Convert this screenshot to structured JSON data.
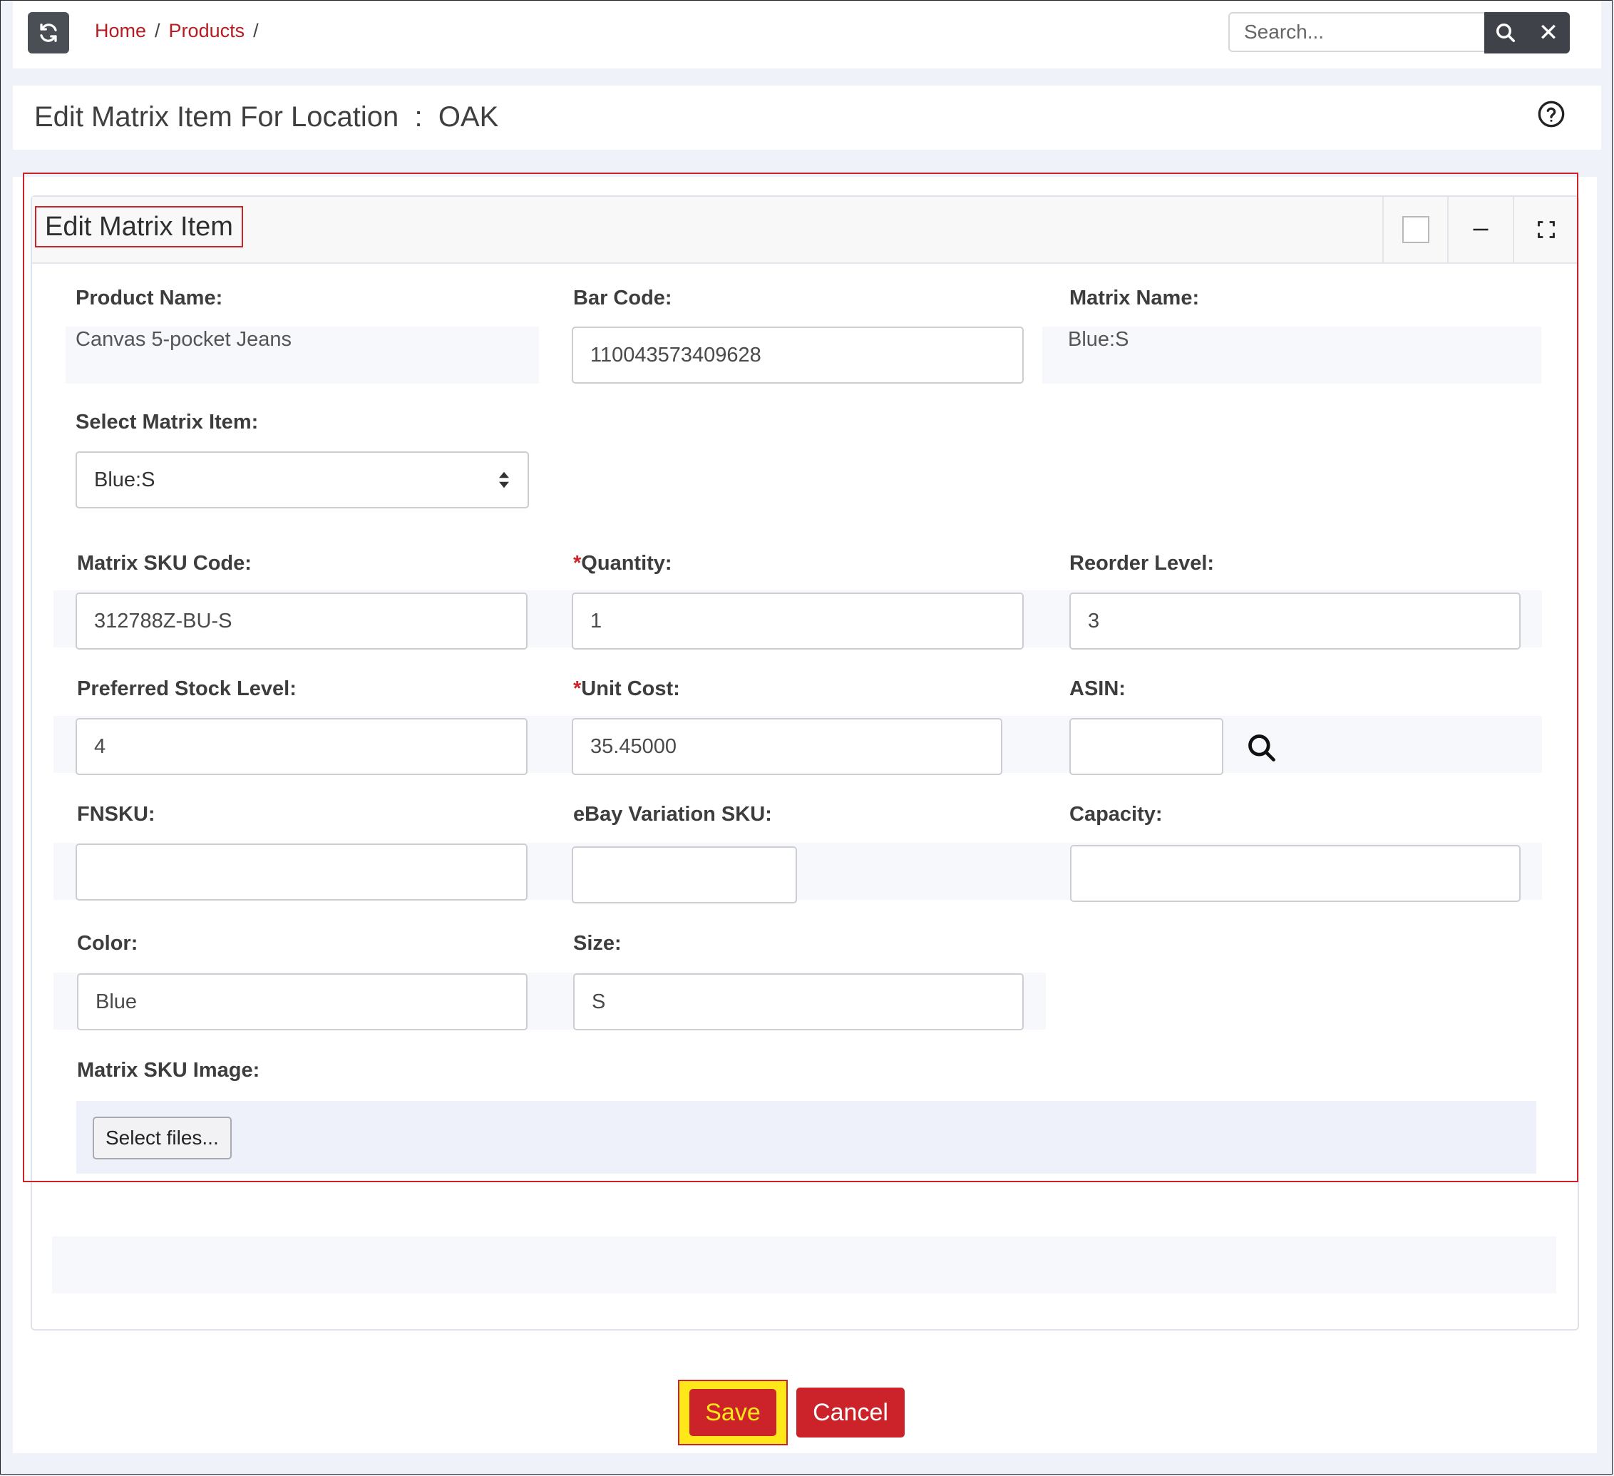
{
  "breadcrumb": {
    "home": "Home",
    "products": "Products",
    "sep": "/"
  },
  "search": {
    "placeholder": "Search...",
    "clear_glyph": "✕"
  },
  "page": {
    "title": "Edit Matrix Item For Location  :  OAK"
  },
  "box": {
    "title": "Edit Matrix Item"
  },
  "form": {
    "product_name_label": "Product Name:",
    "product_name": "Canvas 5-pocket Jeans",
    "bar_code_label": "Bar Code:",
    "bar_code": "110043573409628",
    "matrix_name_label": "Matrix Name:",
    "matrix_name": "Blue:S",
    "select_matrix_label": "Select Matrix Item:",
    "select_matrix_value": "Blue:S",
    "matrix_sku_label": "Matrix SKU Code:",
    "matrix_sku": "312788Z-BU-S",
    "required_mark": "*",
    "quantity_label": "Quantity:",
    "quantity": "1",
    "reorder_label": "Reorder Level:",
    "reorder": "3",
    "preferred_label": "Preferred Stock Level:",
    "preferred": "4",
    "unit_cost_label": "Unit Cost:",
    "unit_cost": "35.45000",
    "asin_label": "ASIN:",
    "asin": "",
    "fnsku_label": "FNSKU:",
    "fnsku": "",
    "ebay_label": "eBay Variation SKU:",
    "ebay": "",
    "capacity_label": "Capacity:",
    "capacity": "",
    "color_label": "Color:",
    "color": "Blue",
    "size_label": "Size:",
    "size": "S",
    "image_label": "Matrix SKU Image:",
    "select_files": "Select files..."
  },
  "actions": {
    "save": "Save",
    "cancel": "Cancel"
  },
  "colors": {
    "accent": "#cc2229",
    "highlight": "#ffe81a",
    "dark_button": "#3f4349"
  }
}
